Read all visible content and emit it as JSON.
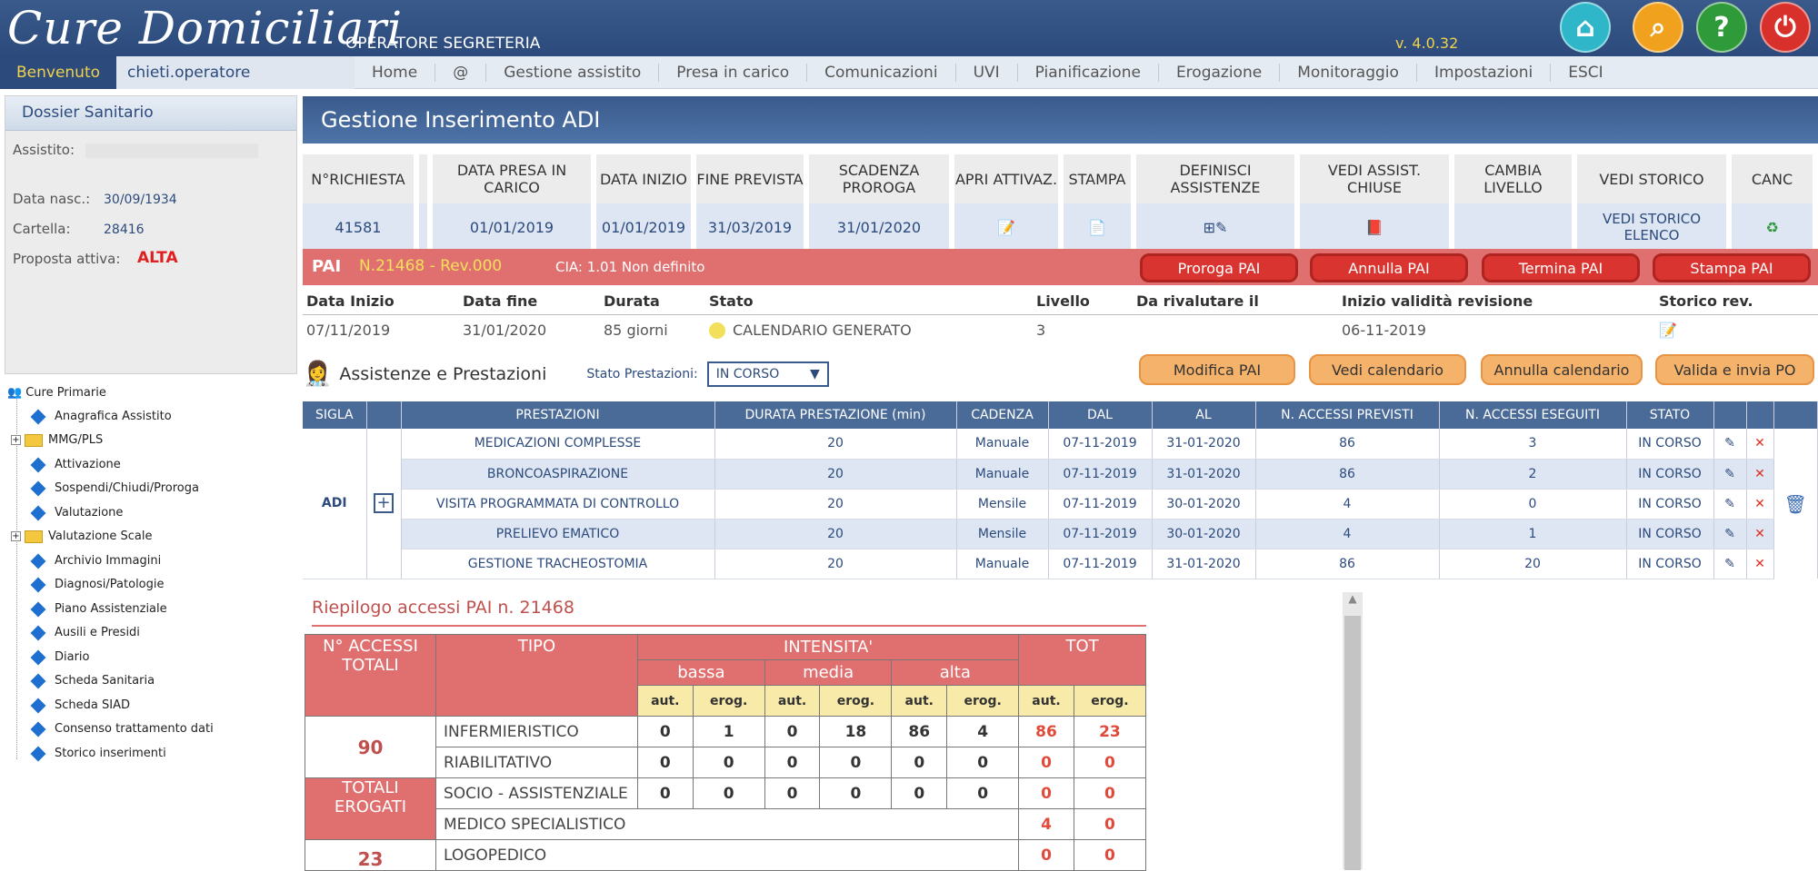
{
  "app": {
    "logo": "Cure Domiciliari",
    "role": "OPERATORE SEGRETERIA",
    "version": "v. 4.0.32",
    "welcome": "Benvenuto",
    "user": "chieti.operatore"
  },
  "menu": [
    "Home",
    "@",
    "Gestione assistito",
    "Presa in carico",
    "Comunicazioni",
    "UVI",
    "Pianificazione",
    "Erogazione",
    "Monitoraggio",
    "Impostazioni",
    "ESCI"
  ],
  "dossier": {
    "title": "Dossier Sanitario",
    "assistito_label": "Assistito:",
    "data_nasc_label": "Data nasc.:",
    "data_nasc": "30/09/1934",
    "cartella_label": "Cartella:",
    "cartella": "28416",
    "proposta_label": "Proposta attiva:",
    "proposta": "ALTA"
  },
  "tree": {
    "root": "Cure Primarie",
    "items": [
      "Anagrafica Assistito",
      "MMG/PLS",
      "Attivazione",
      "Sospendi/Chiudi/Proroga",
      "Valutazione",
      "Valutazione Scale",
      "Archivio Immagini",
      "Diagnosi/Patologie",
      "Piano Assistenziale",
      "Ausili e Presidi",
      "Diario",
      "Scheda Sanitaria",
      "Scheda SIAD",
      "Consenso trattamento dati",
      "Storico inserimenti"
    ]
  },
  "page_title": "Gestione Inserimento ADI",
  "req_headers": [
    "N°RICHIESTA",
    "DATA PRESA IN CARICO",
    "DATA INIZIO",
    "FINE PREVISTA",
    "SCADENZA PROROGA",
    "APRI ATTIVAZ.",
    "STAMPA",
    "DEFINISCI ASSISTENZE",
    "VEDI ASSIST. CHIUSE",
    "CAMBIA LIVELLO",
    "VEDI STORICO",
    "CANC"
  ],
  "req_row": {
    "n": "41581",
    "presa": "01/01/2019",
    "inizio": "01/01/2019",
    "fine": "31/03/2019",
    "scadenza": "31/01/2020",
    "storico": "VEDI STORICO ELENCO"
  },
  "pai": {
    "label": "PAI",
    "code": "N.21468 - Rev.000",
    "cia": "CIA: 1.01 Non definito",
    "buttons": [
      "Proroga PAI",
      "Annulla PAI",
      "Termina PAI",
      "Stampa PAI"
    ]
  },
  "info_headers": [
    "Data Inizio",
    "Data fine",
    "Durata",
    "Stato",
    "Livello",
    "Da rivalutare il",
    "Inizio validità revisione",
    "Storico rev."
  ],
  "info_row": {
    "inizio": "07/11/2019",
    "fine": "31/01/2020",
    "durata": "85 giorni",
    "stato": "CALENDARIO GENERATO",
    "livello": "3",
    "rivalutare": "",
    "validita": "06-11-2019"
  },
  "assist": {
    "title": "Assistenze e Prestazioni",
    "stato_label": "Stato Prestazioni:",
    "stato_value": "IN CORSO",
    "buttons": [
      "Modifica PAI",
      "Vedi calendario",
      "Annulla calendario",
      "Valida e invia PO"
    ]
  },
  "grid_headers": [
    "SIGLA",
    "PRESTAZIONI",
    "DURATA PRESTAZIONE (min)",
    "CADENZA",
    "DAL",
    "AL",
    "N. ACCESSI PREVISTI",
    "N. ACCESSI ESEGUITI",
    "STATO"
  ],
  "sigla": "ADI",
  "rows": [
    {
      "p": "MEDICAZIONI COMPLESSE",
      "d": "20",
      "c": "Manuale",
      "dal": "07-11-2019",
      "al": "31-01-2020",
      "prev": "86",
      "es": "3",
      "st": "IN CORSO"
    },
    {
      "p": "BRONCOASPIRAZIONE",
      "d": "20",
      "c": "Manuale",
      "dal": "07-11-2019",
      "al": "31-01-2020",
      "prev": "86",
      "es": "2",
      "st": "IN CORSO"
    },
    {
      "p": "VISITA PROGRAMMATA DI CONTROLLO",
      "d": "20",
      "c": "Mensile",
      "dal": "07-11-2019",
      "al": "30-01-2020",
      "prev": "4",
      "es": "0",
      "st": "IN CORSO"
    },
    {
      "p": "PRELIEVO EMATICO",
      "d": "20",
      "c": "Mensile",
      "dal": "07-11-2019",
      "al": "30-01-2020",
      "prev": "4",
      "es": "1",
      "st": "IN CORSO"
    },
    {
      "p": "GESTIONE TRACHEOSTOMIA",
      "d": "20",
      "c": "Manuale",
      "dal": "07-11-2019",
      "al": "31-01-2020",
      "prev": "86",
      "es": "20",
      "st": "IN CORSO"
    }
  ],
  "riepilogo": {
    "title": "Riepilogo accessi PAI n. 21468",
    "acc_tot": "N° ACCESSI TOTALI",
    "acc_val": "90",
    "erog_tot": "TOTALI EROGATI",
    "erog_val": "23",
    "tipo": "TIPO",
    "intensita": "INTENSITA'",
    "tot": "TOT",
    "levels": [
      "bassa",
      "media",
      "alta"
    ],
    "aut": "aut.",
    "erog": "erog.",
    "rows": [
      {
        "t": "INFERMIERISTICO",
        "v": [
          "0",
          "1",
          "0",
          "18",
          "86",
          "4"
        ],
        "ta": "86",
        "te": "23"
      },
      {
        "t": "RIABILITATIVO",
        "v": [
          "0",
          "0",
          "0",
          "0",
          "0",
          "0"
        ],
        "ta": "0",
        "te": "0"
      },
      {
        "t": "SOCIO - ASSISTENZIALE",
        "v": [
          "0",
          "0",
          "0",
          "0",
          "0",
          "0"
        ],
        "ta": "0",
        "te": "0"
      },
      {
        "t": "MEDICO SPECIALISTICO",
        "v": [],
        "ta": "4",
        "te": "0"
      },
      {
        "t": "LOGOPEDICO",
        "v": [],
        "ta": "0",
        "te": "0"
      }
    ]
  }
}
